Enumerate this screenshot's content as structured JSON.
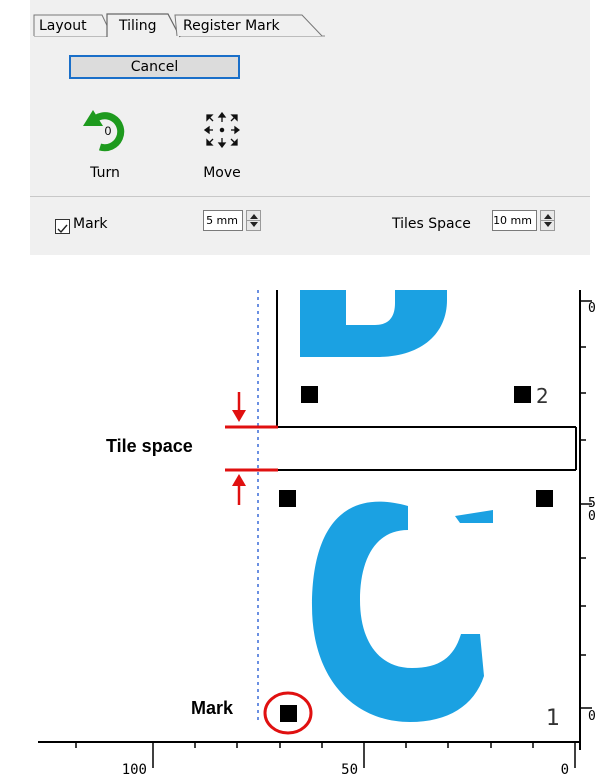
{
  "tabs": [
    {
      "label": "Layout"
    },
    {
      "label": "Tiling"
    },
    {
      "label": "Register Mark"
    }
  ],
  "cancel_label": "Cancel",
  "turn": {
    "label": "Turn",
    "value": "0",
    "icon": "rotate-icon",
    "color": "#1e9a1e"
  },
  "move": {
    "label": "Move",
    "icon": "move-arrows-icon"
  },
  "mark": {
    "label": "Mark",
    "checked": true,
    "value": "5 mm"
  },
  "tiles_space": {
    "label": "Tiles Space",
    "value": "10 mm"
  },
  "canvas": {
    "tile_numbers": [
      "2",
      "1"
    ],
    "right_ruler": [
      "0",
      "5",
      "0",
      "0"
    ],
    "bottom_ruler": [
      "100",
      "50",
      "0"
    ],
    "letter_color": "#1ba1e2",
    "annotation_color": "#e01010"
  },
  "annotations": {
    "tile_space": "Tile space",
    "mark": "Mark"
  }
}
